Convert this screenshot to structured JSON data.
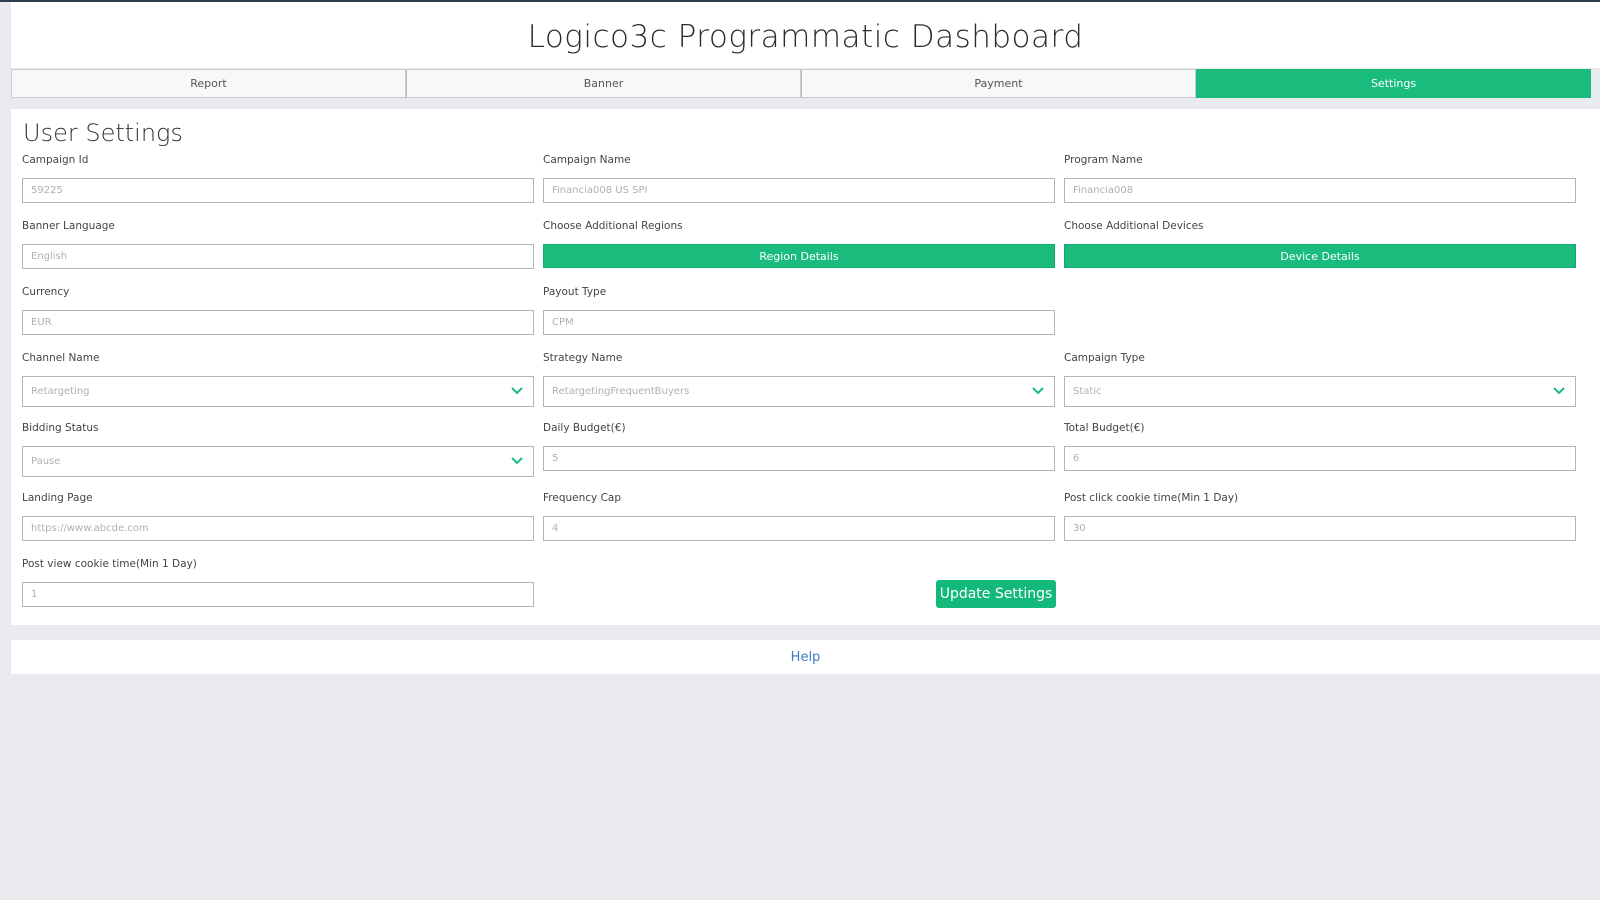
{
  "app": {
    "title": "Logico3c Programmatic Dashboard"
  },
  "tabs": [
    {
      "label": "Report",
      "active": false
    },
    {
      "label": "Banner",
      "active": false
    },
    {
      "label": "Payment",
      "active": false
    },
    {
      "label": "Settings",
      "active": true
    }
  ],
  "panel": {
    "title": "User Settings",
    "fields": {
      "campaign_id": {
        "label": "Campaign Id",
        "placeholder": "59225"
      },
      "campaign_name": {
        "label": "Campaign Name",
        "placeholder": "Financia008 US SPI"
      },
      "program_name": {
        "label": "Program Name",
        "placeholder": "Financia008"
      },
      "banner_language": {
        "label": "Banner Language",
        "placeholder": "English"
      },
      "additional_regions": {
        "label": "Choose Additional Regions",
        "button": "Region Details"
      },
      "additional_devices": {
        "label": "Choose Additional Devices",
        "button": "Device Details"
      },
      "currency": {
        "label": "Currency",
        "placeholder": "EUR"
      },
      "payout_type": {
        "label": "Payout Type",
        "placeholder": "CPM"
      },
      "channel_name": {
        "label": "Channel Name",
        "value": "Retargeting"
      },
      "strategy_name": {
        "label": "Strategy Name",
        "value": "RetargetingFrequentBuyers"
      },
      "campaign_type": {
        "label": "Campaign Type",
        "value": "Static"
      },
      "bidding_status": {
        "label": "Bidding Status",
        "value": "Pause"
      },
      "daily_budget": {
        "label": "Daily Budget(€)",
        "placeholder": "5"
      },
      "total_budget": {
        "label": "Total Budget(€)",
        "placeholder": "6"
      },
      "landing_page": {
        "label": "Landing Page",
        "placeholder": "https://www.abcde.com"
      },
      "frequency_cap": {
        "label": "Frequency Cap",
        "placeholder": "4"
      },
      "post_click_cookie": {
        "label": "Post click cookie time(Min 1 Day)",
        "placeholder": "30"
      },
      "post_view_cookie": {
        "label": "Post view cookie time(Min 1 Day)",
        "placeholder": "1"
      }
    },
    "update_button": "Update Settings"
  },
  "footer": {
    "help": "Help"
  },
  "colors": {
    "accent": "#1abc7e",
    "link": "#3b7bc0",
    "background": "#e9ebee"
  },
  "icons": {
    "select_arrow": "chevron-down-icon"
  }
}
